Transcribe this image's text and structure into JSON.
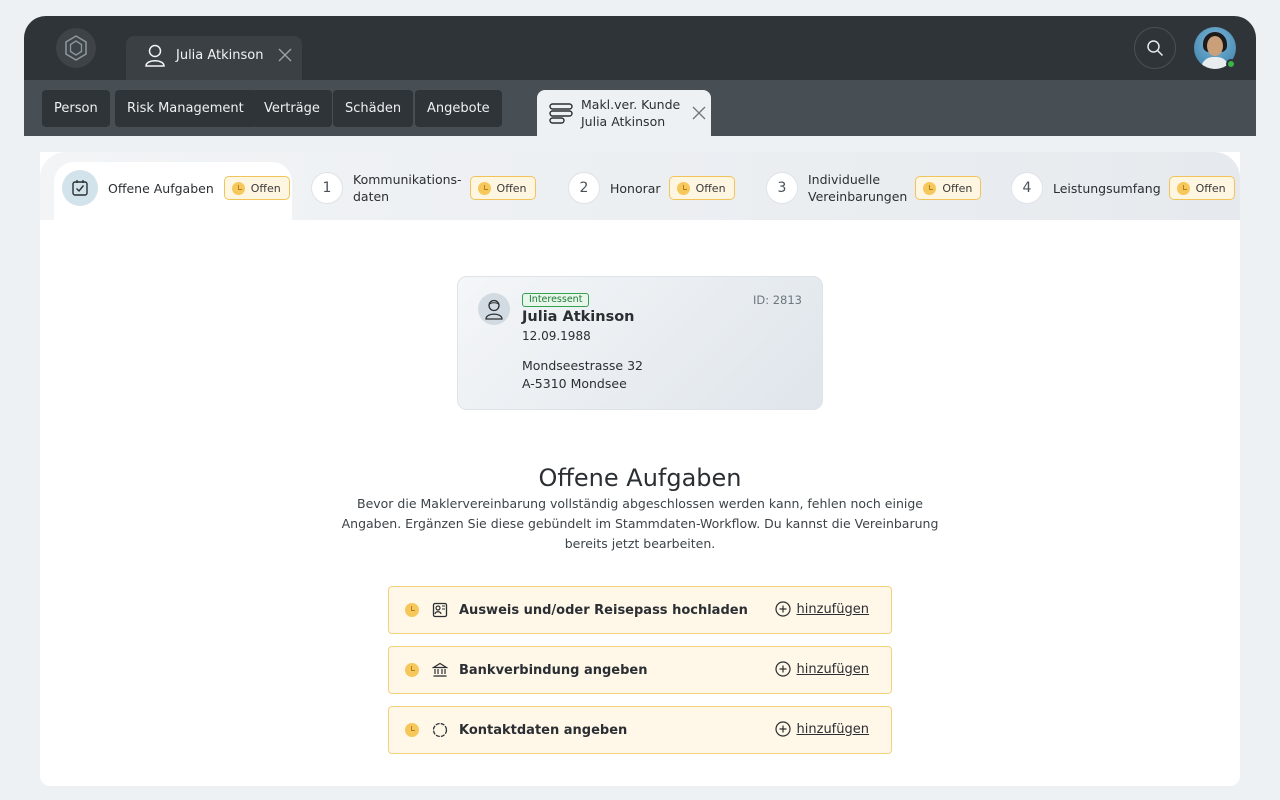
{
  "topbar": {
    "person_tab_label": "Julia Atkinson"
  },
  "nav": {
    "items": [
      {
        "label": "Person"
      },
      {
        "label": "Risk Management"
      },
      {
        "label": "Verträge"
      },
      {
        "label": "Schäden"
      },
      {
        "label": "Angebote"
      }
    ]
  },
  "doc_tab": {
    "line1": "Makl.ver. Kunde",
    "line2": "Julia Atkinson"
  },
  "steps": [
    {
      "number": "",
      "label": "Offene Aufgaben",
      "status": "Offen",
      "icon": "checkbox-icon"
    },
    {
      "number": "1",
      "label_line1": "Kommunikations-",
      "label_line2": "daten",
      "status": "Offen"
    },
    {
      "number": "2",
      "label": "Honorar",
      "status": "Offen"
    },
    {
      "number": "3",
      "label_line1": "Individuelle",
      "label_line2": "Vereinbarungen",
      "status": "Offen"
    },
    {
      "number": "4",
      "label": "Leistungsumfang",
      "status": "Offen"
    }
  ],
  "person_card": {
    "tag": "Interessent",
    "id": "ID: 2813",
    "name": "Julia Atkinson",
    "dob": "12.09.1988",
    "address_line1": "Mondseestrasse 32",
    "address_line2": "A-5310 Mondsee"
  },
  "main": {
    "title": "Offene Aufgaben",
    "description": "Bevor die Maklervereinbarung vollständig abgeschlossen werden kann, fehlen noch einige Angaben. Ergänzen Sie diese gebündelt im Stammdaten-Workflow. Du kannst die Vereinbarung bereits jetzt bearbeiten."
  },
  "tasks": [
    {
      "label": "Ausweis und/oder Reisepass hochladen",
      "icon": "id-card-icon",
      "action": "hinzufügen"
    },
    {
      "label": "Bankverbindung angeben",
      "icon": "bank-icon",
      "action": "hinzufügen"
    },
    {
      "label": "Kontaktdaten angeben",
      "icon": "contact-icon",
      "action": "hinzufügen"
    }
  ],
  "colors": {
    "topbar": "#2f3438",
    "navbar": "#474f55",
    "badge_border": "#f0c45a",
    "badge_bg": "#fff6e2",
    "task_bg": "#fff7e8",
    "tag_green": "#35a153"
  }
}
